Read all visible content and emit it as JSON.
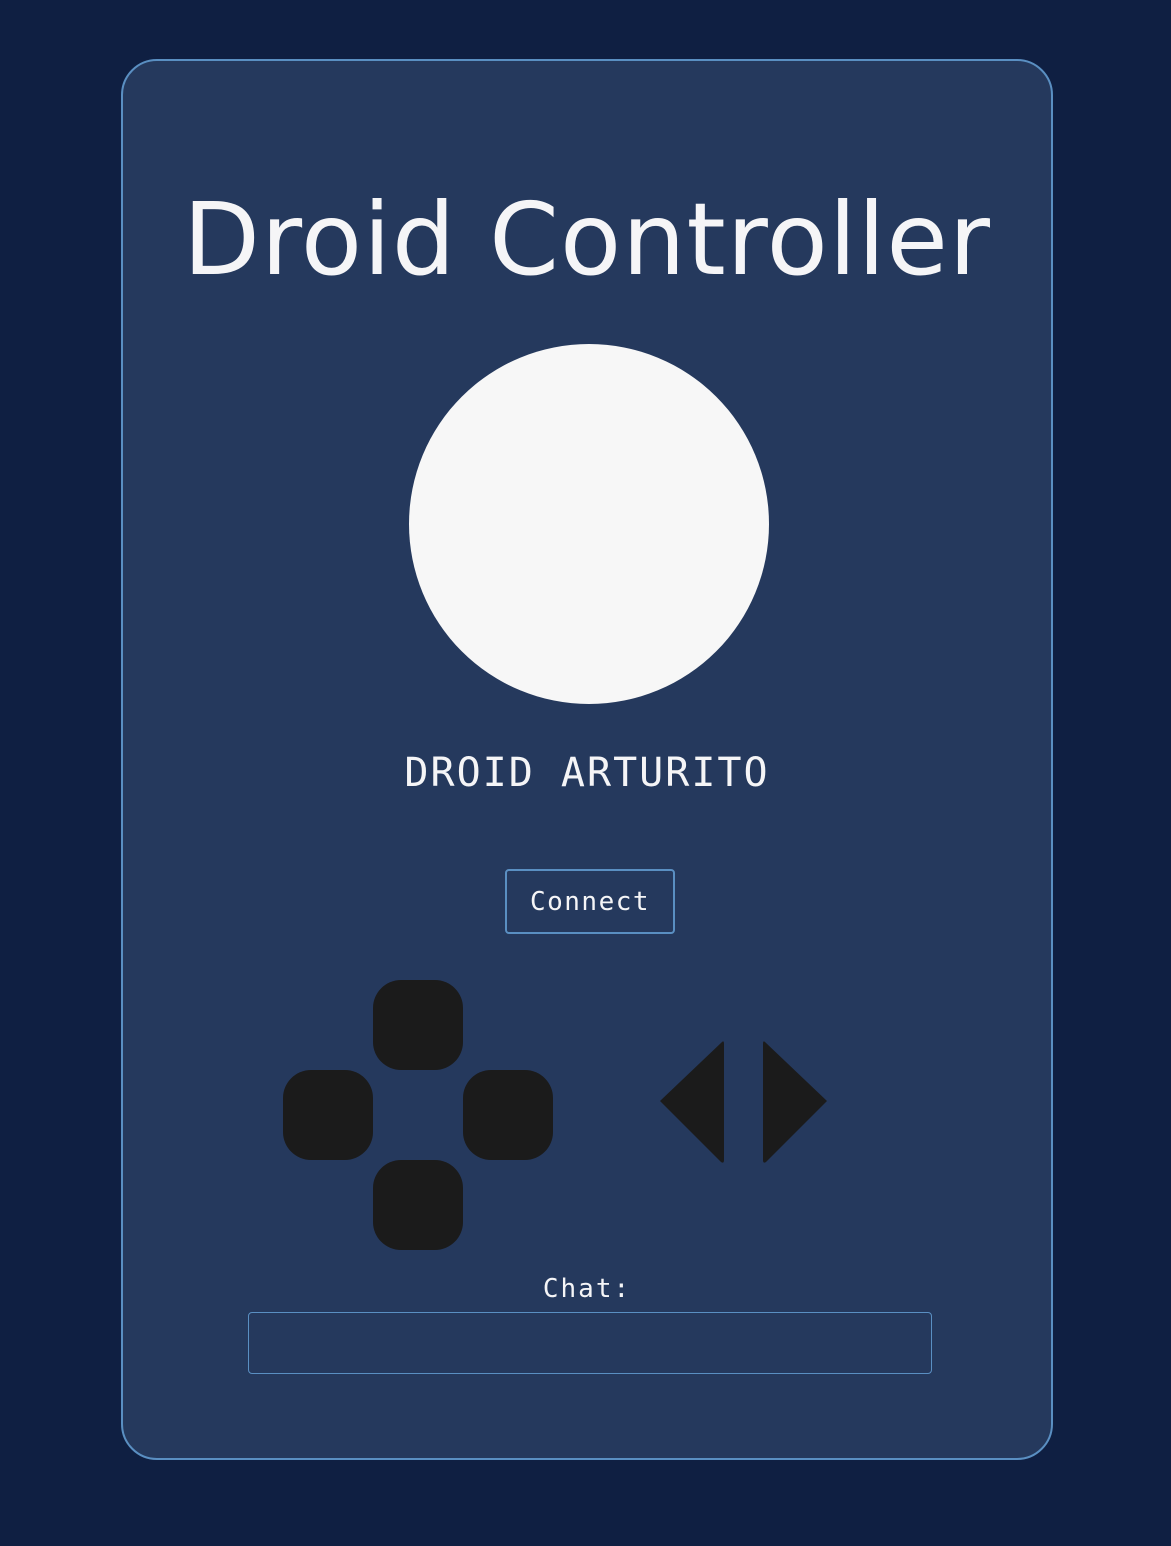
{
  "header": {
    "title": "Droid Controller"
  },
  "droid": {
    "name": "DROID ARTURITO"
  },
  "connection": {
    "button_label": "Connect"
  },
  "controls": {
    "dpad": [
      "up",
      "left",
      "right",
      "down"
    ],
    "rotate": [
      "rotate-left",
      "rotate-right"
    ]
  },
  "chat": {
    "label": "Chat:",
    "value": "",
    "placeholder": ""
  },
  "colors": {
    "page_background": "#0f1f42",
    "card_background": "#25395d",
    "accent_border": "#5a8fc2",
    "text": "#f5f5f7",
    "control": "#1b1b1b",
    "avatar": "#f7f7f7"
  }
}
